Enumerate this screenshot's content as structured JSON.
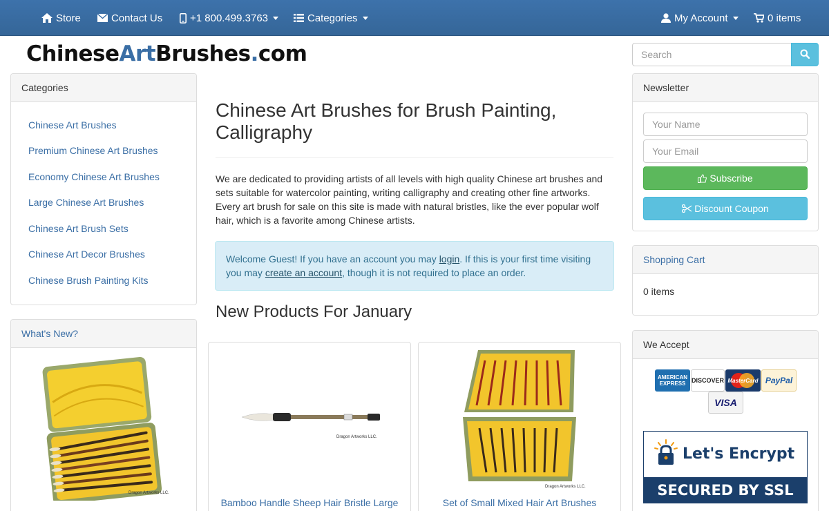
{
  "nav": {
    "store": "Store",
    "contact": "Contact Us",
    "phone": "+1 800.499.3763",
    "categories": "Categories",
    "account": "My Account",
    "cart": "0 items"
  },
  "logo": {
    "part1": "Chinese",
    "part2": "Art",
    "part3": "Brushes",
    "dot": ".",
    "part4": "com"
  },
  "search": {
    "placeholder": "Search"
  },
  "categories": {
    "title": "Categories",
    "items": [
      "Chinese Art Brushes",
      "Premium Chinese Art Brushes",
      "Economy Chinese Art Brushes",
      "Large Chinese Art Brushes",
      "Chinese Art Brush Sets",
      "Chinese Art Decor Brushes",
      "Chinese Brush Painting Kits"
    ]
  },
  "whats_new": {
    "title": "What's New?",
    "watermark": "Dragon Artworks LLC."
  },
  "main": {
    "title": "Chinese Art Brushes for Brush Painting, Calligraphy",
    "intro": "We are dedicated to providing artists of all levels with high quality Chinese art brushes and sets suitable for watercolor painting, writing calligraphy and creating other fine artworks. Every art brush for sale on this site is made with natural bristles, like the ever popular wolf hair, which is a favorite among Chinese artists.",
    "alert": {
      "text1": "Welcome Guest! If you have an account you may ",
      "login": "login",
      "text2": ". If this is your first time visiting you may ",
      "create": "create an account",
      "text3": ", though it is not required to place an order."
    },
    "new_title": "New Products For January",
    "products": [
      {
        "name": "Bamboo Handle Sheep Hair Bristle Large",
        "watermark": "Dragon Artworks LLC."
      },
      {
        "name": "Set of Small Mixed Hair Art Brushes",
        "watermark": "Dragon Artworks LLC."
      }
    ]
  },
  "newsletter": {
    "title": "Newsletter",
    "name_placeholder": "Your Name",
    "email_placeholder": "Your Email",
    "subscribe": "Subscribe",
    "coupon": "Discount Coupon"
  },
  "cart": {
    "title": "Shopping Cart",
    "items": "0 items"
  },
  "accept": {
    "title": "We Accept",
    "amex1": "AMERICAN",
    "amex2": "EXPRESS",
    "discover": "DISCOVER",
    "mastercard": "MasterCard",
    "paypal": "PayPal",
    "visa": "VISA",
    "ssl1": "Let's Encrypt",
    "ssl2": "SECURED BY SSL"
  },
  "colors": {
    "navbar": "#3a6ea5",
    "link": "#3a6ea5",
    "success": "#5cb85c",
    "info": "#5bc0de"
  }
}
